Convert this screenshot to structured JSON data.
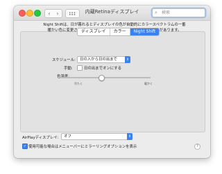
{
  "window": {
    "title": "内蔵Retinaディスプレイ"
  },
  "toolbar": {
    "back_glyph": "‹",
    "forward_glyph": "›",
    "search_placeholder": "検索"
  },
  "tabs": [
    {
      "label": "ディスプレイ",
      "active": false
    },
    {
      "label": "カラー",
      "active": false
    },
    {
      "label": "Night Shift",
      "active": true
    }
  ],
  "night_shift": {
    "description": "Night Shiftは、日が暮れるとディスプレイの色が自動的にカラースペクトラムの一番暖かい色に変更されます。これは、寝よく眠るのに役に立つ可能性があります。",
    "schedule_label": "スケジュール:",
    "schedule_value": "日の入から日の出まで",
    "manual_label": "手動:",
    "manual_checkbox_label": "日の出までオンにする",
    "manual_checked": false,
    "color_temp_label": "色温度:",
    "slider_min_label": "冷たく",
    "slider_max_label": "暖かく",
    "color_temp_level": 0.45
  },
  "airplay": {
    "label": "AirPlayディスプレイ:",
    "value": "オフ"
  },
  "mirroring": {
    "label": "使用可能な場合はメニューバーにミラーリングオプションを表示",
    "checked": true
  },
  "help_glyph": "?",
  "colors": {
    "accent": "#3b82f0",
    "window_bg": "#ececec",
    "panel_bg": "#e2e2e2"
  },
  "icons": [
    "back-icon",
    "forward-icon",
    "show-all-grid-icon",
    "search-icon",
    "popup-arrows-icon",
    "checkmark-icon",
    "help-icon"
  ]
}
